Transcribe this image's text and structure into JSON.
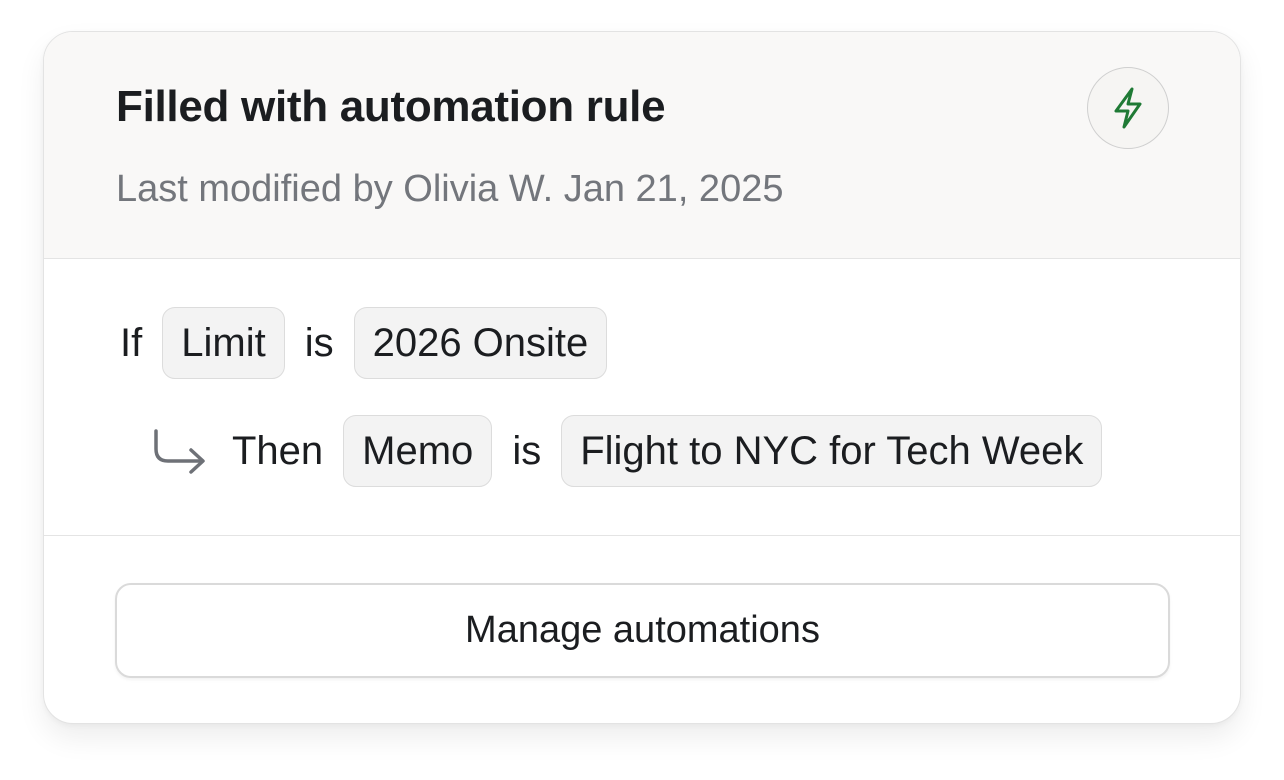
{
  "header": {
    "title": "Filled with automation rule",
    "subtitle": "Last modified by Olivia W. Jan 21, 2025",
    "action_icon": "lightning-bolt-icon",
    "accent_color": "#1f7a35"
  },
  "rule": {
    "condition": {
      "keyword": "If",
      "field": "Limit",
      "operator": "is",
      "value": "2026 Onsite"
    },
    "action": {
      "arrow_icon": "return-arrow-icon",
      "keyword": "Then",
      "field": "Memo",
      "operator": "is",
      "value": "Flight to NYC for Tech Week"
    }
  },
  "footer": {
    "button_label": "Manage automations"
  }
}
